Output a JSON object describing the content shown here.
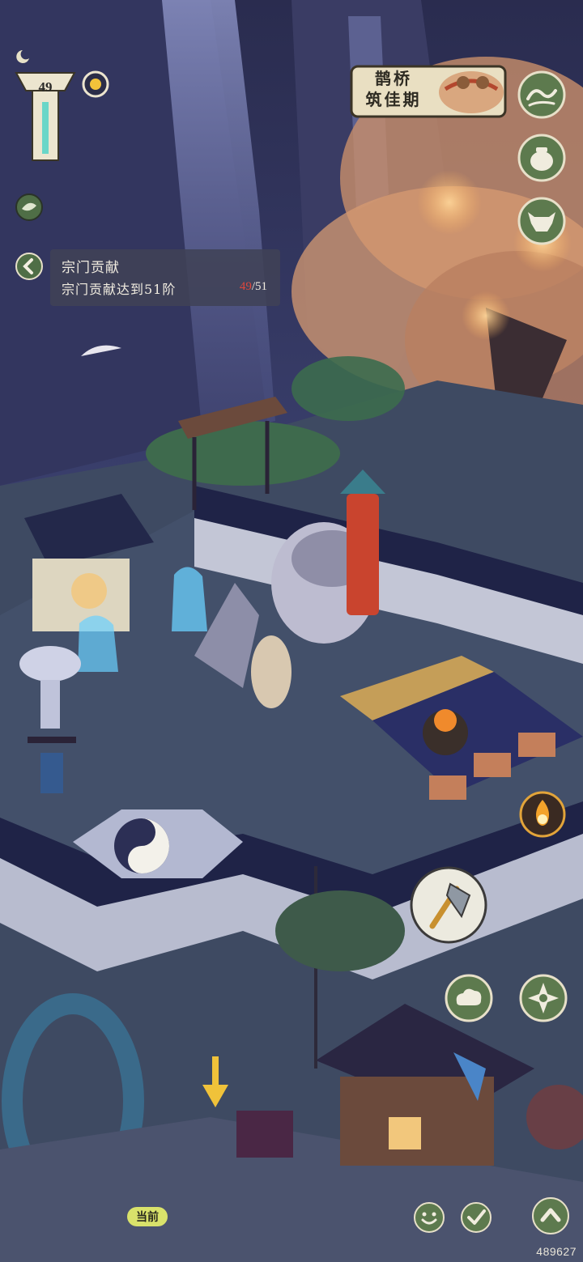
{
  "hud": {
    "level": "49"
  },
  "quest": {
    "title": "宗门贡献",
    "description": "宗门贡献达到51阶",
    "progress_current": "49",
    "progress_total": "/51"
  },
  "event": {
    "line1": "鹊桥",
    "line2": "筑佳期"
  },
  "footer": {
    "current_label": "当前",
    "uid": "489627"
  },
  "icons": {
    "right_column": [
      "wave-icon",
      "pot-icon",
      "ox-mask-icon"
    ],
    "action_buttons": [
      "axe-icon",
      "cloud-icon",
      "compass-icon",
      "fire-spirit-icon"
    ],
    "bottom_buttons": [
      "face-icon",
      "check-leaf-icon",
      "up-arrow-icon"
    ]
  },
  "colors": {
    "ui_green": "#5d7a4e",
    "ui_ring": "#e7e0c9",
    "progress_red": "#e0473c"
  }
}
